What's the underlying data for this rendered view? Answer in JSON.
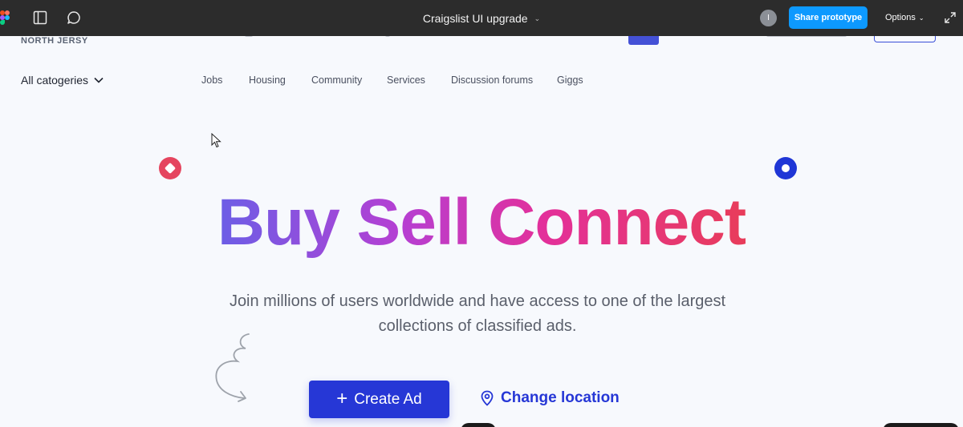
{
  "topbar": {
    "title": "Craigslist UI upgrade",
    "avatar_initial": "I",
    "share_label": "Share prototype",
    "options_label": "Options",
    "accent": "#0d99ff"
  },
  "site": {
    "brand_sub": "NORTH JERSY",
    "all_categories": "All catogeries",
    "nav": [
      "Jobs",
      "Housing",
      "Community",
      "Services",
      "Discussion forums",
      "Giggs"
    ]
  },
  "hero": {
    "title": "Buy Sell Connect",
    "subtitle": "Join millions of users worldwide and have access to one of the largest collections of classified ads.",
    "create_ad": "Create Ad",
    "change_location": "Change location",
    "primary_color": "#2637d6"
  },
  "icons": {
    "figma": "figma-logo-icon",
    "sidebar": "sidebar-toggle-icon",
    "comment": "comment-icon",
    "expand": "expand-icon",
    "plus": "plus-icon",
    "location": "location-pin-icon"
  }
}
